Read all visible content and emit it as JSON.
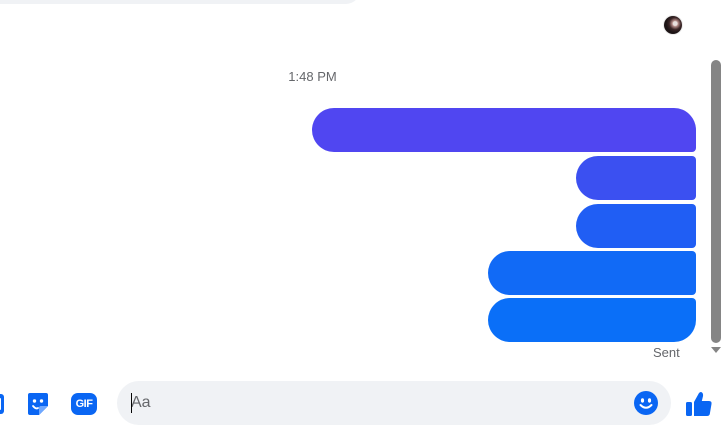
{
  "thread": {
    "timestamp": "1:48 PM",
    "status": "Sent",
    "messages": [
      {
        "text": "",
        "color": "#5046f1"
      },
      {
        "text": "",
        "color": "#3b50f1"
      },
      {
        "text": "",
        "color": "#205ef4"
      },
      {
        "text": "",
        "color": "#116af6"
      },
      {
        "text": "",
        "color": "#0a6ff8"
      }
    ]
  },
  "composer": {
    "placeholder": "Aa",
    "value": "",
    "tools": [
      {
        "name": "attach-icon"
      },
      {
        "name": "sticker-icon"
      },
      {
        "name": "gif-icon",
        "label": "GIF"
      }
    ],
    "emoji_icon": "smiley-icon",
    "send_icon": "thumbs-up-icon",
    "accent_color": "#0a66f3"
  },
  "colors": {
    "background": "#ffffff",
    "input_background": "#f0f2f5",
    "muted_text": "#65676b",
    "scrollbar": "#858585"
  }
}
